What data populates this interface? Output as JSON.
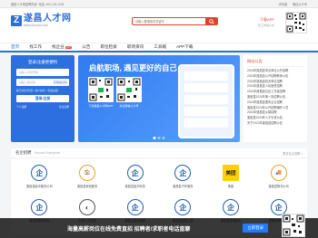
{
  "topbar": {
    "left": "遂昌人才网招聘热线: 电话: 400-123-1234",
    "right": [
      "手机端",
      "微信公众号"
    ]
  },
  "logo": {
    "mark": "Z",
    "name": "遂昌人才网",
    "domain": "www.0scrcw.com"
  },
  "search": {
    "placeholder": "请输入要搜索的关键字"
  },
  "app_download": {
    "title": "下载APP",
    "subtitle": "找工作招人才"
  },
  "nav": {
    "items": [
      "首页",
      "找工作",
      "找企业",
      "公告",
      "职位检索",
      "职场资讯",
      "工具箱",
      "APP下载"
    ],
    "badge": "HOT"
  },
  "login": {
    "title": "登录/注册更便利",
    "phone_placeholder": "请输入手机号码",
    "code_placeholder": "请输入验证码",
    "code_button": "获取验证码",
    "agree": "我已阅读并同意《用户协议》《隐私政策》",
    "submit": "登录/注册",
    "link_left": "个人注册",
    "link_right": "企业注册"
  },
  "banner": {
    "title": "启航职场, 遇见更好的自己",
    "qr1_caption": "下载遂昌人才网APP",
    "qr2_caption": "关注微信公众号"
  },
  "notice": {
    "title": "网站公告",
    "items": [
      "2024年遂昌县事业单位公开招聘",
      "2024年遂昌县公开招聘教师公告",
      "2024年遂昌县机关单位招聘",
      "2024年遂昌县人民医院招聘",
      "2024年遂昌县社区工作者招聘",
      "遂昌县2024年第一批招聘公告",
      "2024年遂昌县国有企业招聘",
      "遂昌县2024年公开招聘编外人员",
      "2024年遂昌县乡镇招聘",
      "遂昌县2024年人才引进公告",
      "关于2024年遂昌县招聘公告"
    ]
  },
  "companies": {
    "title": "名企招聘",
    "title_en": "Famous Enterprises",
    "more": "更多名企招聘 >",
    "items": [
      {
        "name": "遂昌县鼎丰服务公司",
        "logo": "企",
        "bg": "#ffffff",
        "fg": "#1f5fae"
      },
      {
        "name": "遂昌县家政服务",
        "logo": "🏠",
        "bg": "#ffffff",
        "fg": "#e8a32b"
      },
      {
        "name": "遂昌县鑫华科技",
        "logo": "企",
        "bg": "#ffffff",
        "fg": "#1f5fae"
      },
      {
        "name": "遂昌县汽车服务",
        "logo": "企",
        "bg": "#ffffff",
        "fg": "#1f5fae"
      },
      {
        "name": "美团",
        "logo": "美团",
        "bg": "#ffd100",
        "fg": "#222222"
      },
      {
        "name": "遂昌县物流公司",
        "logo": "🚚",
        "bg": "#ffffff",
        "fg": "#e8a32b"
      },
      {
        "name": "遂昌县教育培训",
        "logo": "企",
        "bg": "#ffffff",
        "fg": "#1f5fae"
      },
      {
        "name": "万家人力资源",
        "logo": "◐",
        "bg": "#ffffff",
        "fg": "#555555"
      },
      {
        "name": "遂昌县酒店管理",
        "logo": "企",
        "bg": "#ffffff",
        "fg": "#1f5fae"
      },
      {
        "name": "遂昌县建筑工程",
        "logo": "企",
        "bg": "#ffffff",
        "fg": "#1f5fae"
      },
      {
        "name": "遂昌县连锁超市",
        "logo": "企",
        "bg": "#ffffff",
        "fg": "#1f5fae"
      },
      {
        "name": "遂昌县商贸公司",
        "logo": "企",
        "bg": "#ffffff",
        "fg": "#1f5fae"
      }
    ]
  },
  "bottom": {
    "text": "海量高薪岗位在线免费直招 招聘者/求职者电话直聊",
    "button": "立即登录"
  },
  "colors": {
    "brand": "#2c6fd6",
    "accent": "#e0422d"
  }
}
